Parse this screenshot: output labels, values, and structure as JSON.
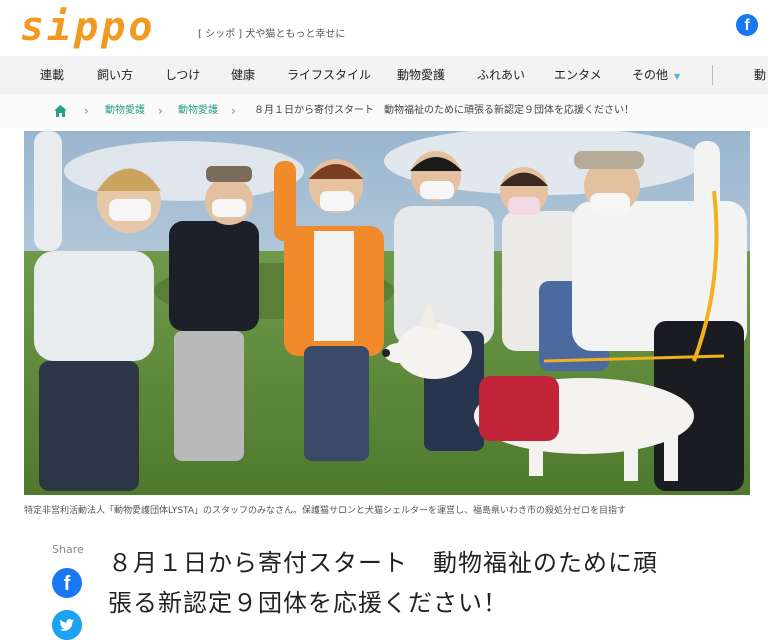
{
  "site": {
    "logo": "sippo",
    "tagline": "[ シッポ ] 犬や猫ともっと幸せに",
    "facebook_glyph": "f"
  },
  "nav": {
    "items": [
      "連載",
      "飼い方",
      "しつけ",
      "健康",
      "ライフスタイル",
      "動物愛護",
      "ふれあい",
      "エンタメ",
      "その他",
      "動"
    ],
    "caret": "▼"
  },
  "breadcrumb": {
    "items": [
      "動物愛護",
      "動物愛護"
    ],
    "separator": "›",
    "current": "８月１日から寄付スタート　動物福祉のために頑張る新認定９団体を応援ください！"
  },
  "photo": {
    "caption": "特定非営利活動法人「動物愛護団体LYSTA」のスタッフのみなさん。保護猫サロンと犬猫シェルターを運営し、福島県いわき市の殺処分ゼロを目指す"
  },
  "share": {
    "label": "Share",
    "facebook_glyph": "f"
  },
  "article": {
    "title_line1": "８月１日から寄付スタート　動物福祉のために頑",
    "title_line2": "張る新認定９団体を応援ください！"
  },
  "colors": {
    "brand": "#f29a1f",
    "link": "#2a9d8f",
    "facebook": "#1877f2",
    "twitter": "#1da1f2"
  },
  "icons": [
    "home-icon",
    "facebook-icon",
    "twitter-icon",
    "chevron-right-icon",
    "caret-down-icon"
  ]
}
